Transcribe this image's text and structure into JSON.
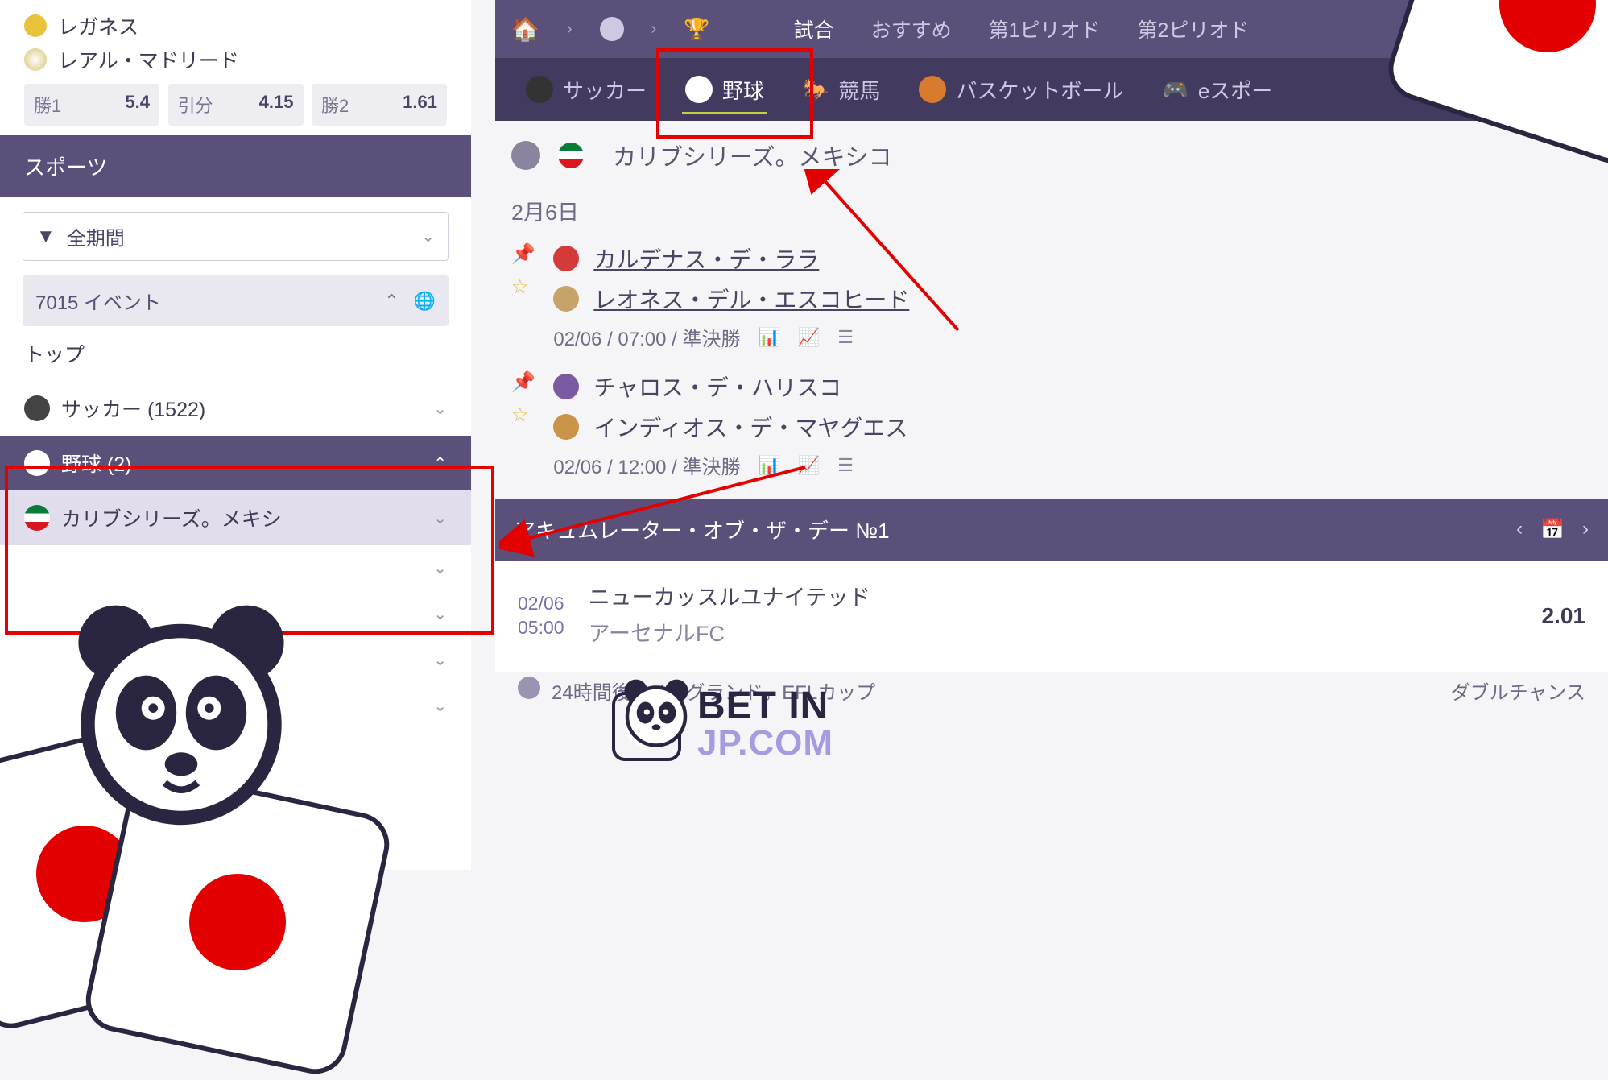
{
  "match_card": {
    "team1": "レガネス",
    "team2": "レアル・マドリード",
    "odd1_label": "勝1",
    "odd1_val": "5.4",
    "draw_label": "引分",
    "draw_val": "4.15",
    "odd2_label": "勝2",
    "odd2_val": "1.61"
  },
  "sports_header": "スポーツ",
  "filter": {
    "label": "全期間"
  },
  "events_count": "7015 イベント",
  "sidebar": {
    "top_label": "トップ",
    "soccer": "サッカー (1522)",
    "baseball": "野球 (2)",
    "league_sub": "カリブシリーズ。メキシ"
  },
  "breadcrumb_tabs": {
    "home": "🏠",
    "t1": "試合",
    "t2": "おすすめ",
    "t3": "第1ピリオド",
    "t4": "第2ピリオド"
  },
  "sportbar": {
    "soccer": "サッカー",
    "baseball": "野球",
    "horse": "競馬",
    "basketball": "バスケットボール",
    "esports": "eスポー"
  },
  "league": {
    "name": "カリブシリーズ。メキシコ"
  },
  "date1": "2月6日",
  "event1": {
    "team1": "カルデナス・デ・ララ",
    "team2": "レオネス・デル・エスコヒード",
    "meta": "02/06 / 07:00 / 準決勝"
  },
  "event2": {
    "team1": "チャロス・デ・ハリスコ",
    "team2": "インディオス・デ・マヤグエス",
    "meta": "02/06 / 12:00 / 準決勝"
  },
  "acc": {
    "title": "アキュムレーター・オブ・ザ・デー №1",
    "time1": "02/06",
    "time2": "05:00",
    "team1": "ニューカッスルユナイテッド",
    "team2": "アーセナルFC",
    "odd": "2.01",
    "foot_left": "24時間後 / イングランド。EFLカップ",
    "foot_right": "ダブルチャンス"
  },
  "watermark": {
    "l1": "BET IN",
    "l2": "JP.COM"
  }
}
